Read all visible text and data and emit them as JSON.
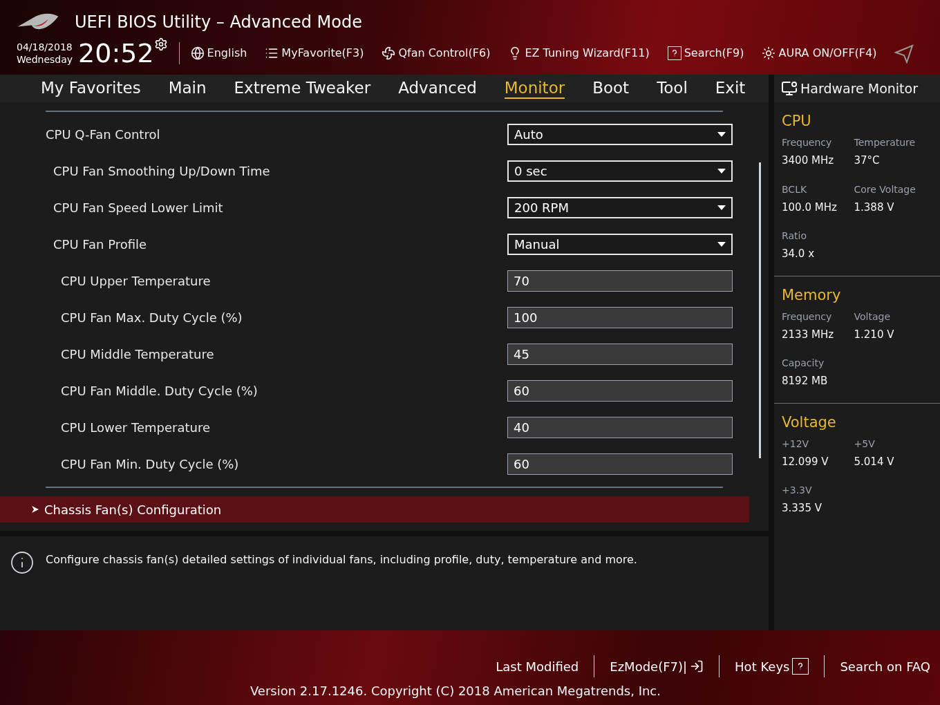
{
  "window": {
    "title": "UEFI BIOS Utility – Advanced Mode"
  },
  "clock": {
    "date": "04/18/2018",
    "weekday": "Wednesday",
    "time": "20:52"
  },
  "toolbar": [
    {
      "kind": "language",
      "label": "English"
    },
    {
      "kind": "favorite",
      "label": "MyFavorite(F3)"
    },
    {
      "kind": "fan",
      "label": "Qfan Control(F6)"
    },
    {
      "kind": "wizard",
      "label": "EZ Tuning Wizard(F11)"
    },
    {
      "kind": "search",
      "label": "Search(F9)"
    },
    {
      "kind": "aura",
      "label": "AURA ON/OFF(F4)"
    }
  ],
  "tabs": [
    {
      "label": "My Favorites",
      "selected": false
    },
    {
      "label": "Main",
      "selected": false
    },
    {
      "label": "Extreme Tweaker",
      "selected": false
    },
    {
      "label": "Advanced",
      "selected": false
    },
    {
      "label": "Monitor",
      "selected": true
    },
    {
      "label": "Boot",
      "selected": false
    },
    {
      "label": "Tool",
      "selected": false
    },
    {
      "label": "Exit",
      "selected": false
    }
  ],
  "settings": [
    {
      "label": "CPU Q-Fan Control",
      "kind": "dropdown",
      "value": "Auto",
      "children": [
        {
          "label": "CPU Fan Smoothing Up/Down Time",
          "kind": "dropdown",
          "value": "0 sec"
        },
        {
          "label": "CPU Fan Speed Lower Limit",
          "kind": "dropdown",
          "value": "200 RPM"
        },
        {
          "label": "CPU Fan Profile",
          "kind": "dropdown",
          "value": "Manual",
          "children": [
            {
              "label": "CPU Upper Temperature",
              "kind": "number",
              "value": "70"
            },
            {
              "label": "CPU Fan Max. Duty Cycle (%)",
              "kind": "number",
              "value": "100"
            },
            {
              "label": "CPU Middle Temperature",
              "kind": "number",
              "value": "45"
            },
            {
              "label": "CPU Fan Middle. Duty Cycle (%)",
              "kind": "number",
              "value": "60"
            },
            {
              "label": "CPU Lower Temperature",
              "kind": "number",
              "value": "40"
            },
            {
              "label": "CPU Fan Min. Duty Cycle (%)",
              "kind": "number",
              "value": "60"
            }
          ]
        }
      ]
    }
  ],
  "submenu": {
    "label": "Chassis Fan(s) Configuration",
    "selected": true
  },
  "help": "Configure chassis fan(s) detailed settings of individual fans, including profile, duty, temperature and more.",
  "hardware_monitor": {
    "title": "Hardware Monitor",
    "sections": [
      {
        "title": "CPU",
        "items": [
          {
            "label": "Frequency",
            "value": "3400 MHz"
          },
          {
            "label": "Temperature",
            "value": "37°C"
          },
          {
            "label": "BCLK",
            "value": "100.0 MHz"
          },
          {
            "label": "Core Voltage",
            "value": "1.388 V"
          },
          {
            "label": "Ratio",
            "value": "34.0 x"
          }
        ]
      },
      {
        "title": "Memory",
        "items": [
          {
            "label": "Frequency",
            "value": "2133 MHz"
          },
          {
            "label": "Voltage",
            "value": "1.210 V"
          },
          {
            "label": "Capacity",
            "value": "8192 MB"
          }
        ]
      },
      {
        "title": "Voltage",
        "items": [
          {
            "label": "+12V",
            "value": "12.099 V"
          },
          {
            "label": "+5V",
            "value": "5.014 V"
          },
          {
            "label": "+3.3V",
            "value": "3.335 V"
          }
        ]
      }
    ]
  },
  "footer": {
    "links": [
      {
        "kind": "text",
        "label": "Last Modified"
      },
      {
        "kind": "exit",
        "label": "EzMode(F7)|"
      },
      {
        "kind": "help",
        "label": "Hot Keys"
      },
      {
        "kind": "text",
        "label": "Search on FAQ"
      }
    ],
    "version": "Version 2.17.1246. Copyright (C) 2018 American Megatrends, Inc."
  }
}
